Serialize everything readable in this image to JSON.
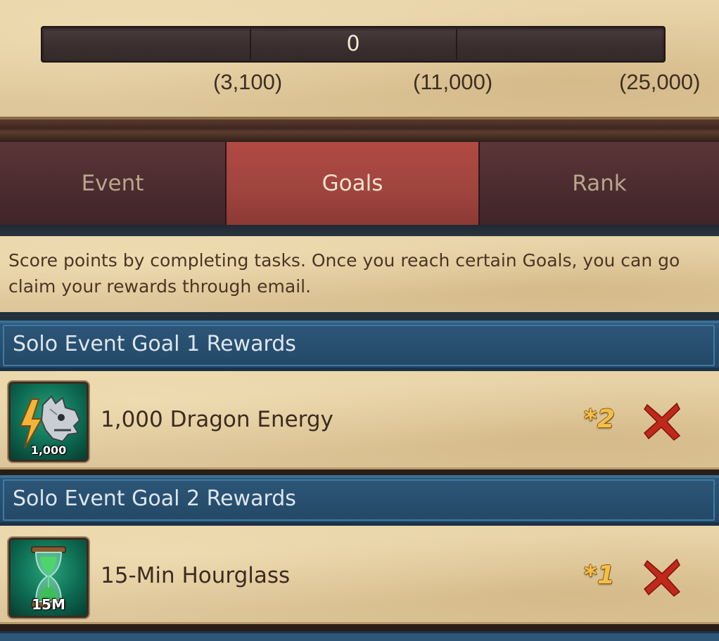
{
  "progress": {
    "current_score": "0",
    "fill_fraction": 0,
    "milestones": [
      "(3,100)",
      "(11,000)",
      "(25,000)"
    ]
  },
  "tabs": [
    {
      "label": "Event",
      "active": false
    },
    {
      "label": "Goals",
      "active": true
    },
    {
      "label": "Rank",
      "active": false
    }
  ],
  "description": "Score points by completing tasks. Once you reach certain Goals, you can go claim your rewards through email.",
  "goals": [
    {
      "title": "Solo Event Goal 1 Rewards",
      "reward": {
        "icon": "dragon-energy-icon",
        "icon_label": "1,000",
        "name": "1,000 Dragon Energy",
        "multiplier": "*2",
        "claimed": false
      }
    },
    {
      "title": "Solo Event Goal 2 Rewards",
      "reward": {
        "icon": "hourglass-icon",
        "icon_label": "15M",
        "name": "15-Min Hourglass",
        "multiplier": "*1",
        "claimed": false
      }
    }
  ],
  "colors": {
    "parchment": "#e8d4a8",
    "tab_active": "#a0443e",
    "tab_inactive": "#4a2b2e",
    "header_blue": "#2d5678",
    "multiplier_gold": "#f2c04a",
    "x_red": "#c0281c"
  }
}
